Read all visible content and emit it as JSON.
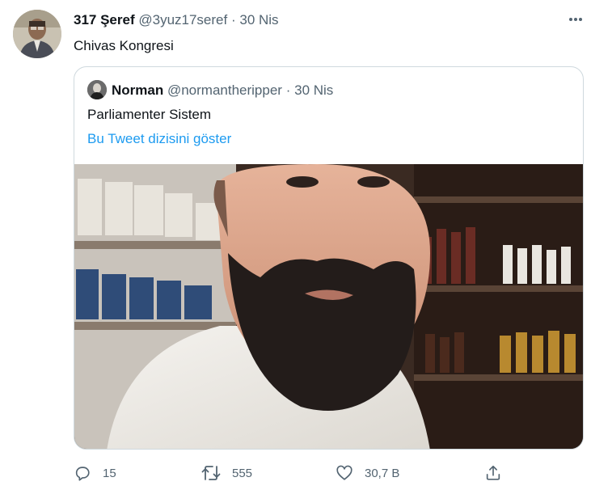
{
  "tweet": {
    "author_name": "317 Şeref",
    "author_handle": "@3yuz17seref",
    "separator": "·",
    "date": "30 Nis",
    "text": "Chivas Kongresi",
    "more_icon": "more-horizontal-icon"
  },
  "quoted_tweet": {
    "author_name": "Norman",
    "author_handle": "@normantheripper",
    "separator": "·",
    "date": "30 Nis",
    "text": "Parliamenter Sistem",
    "thread_link": "Bu Tweet dizisini göster"
  },
  "actions": {
    "reply_count": "15",
    "retweet_count": "555",
    "like_count": "30,7 B",
    "icons": [
      "reply-icon",
      "retweet-icon",
      "like-icon",
      "share-icon"
    ]
  },
  "colors": {
    "text": "#0f1419",
    "secondary": "#536471",
    "link": "#1d9bf0",
    "border": "#cfd9de"
  }
}
